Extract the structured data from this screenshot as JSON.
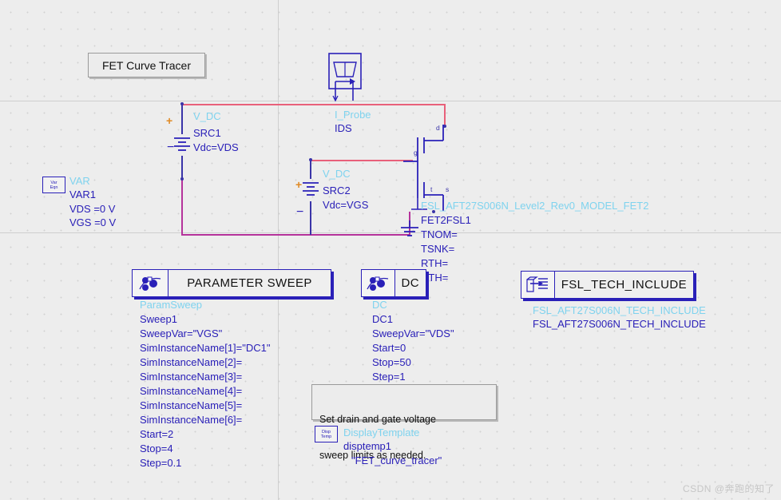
{
  "app": {
    "title_box": "FET Curve Tracer",
    "watermark": "CSDN @奔跑的知了"
  },
  "sources": {
    "src1": {
      "type": "V_DC",
      "name": "SRC1",
      "value": "Vdc=VDS",
      "plus": "+",
      "minus": "−"
    },
    "src2": {
      "type": "V_DC",
      "name": "SRC2",
      "value": "Vdc=VGS",
      "plus": "+",
      "minus": "−"
    }
  },
  "probe": {
    "type": "I_Probe",
    "name": "IDS"
  },
  "var_block": {
    "icon_l1": "Var",
    "icon_l2": "Eqn",
    "type": "VAR",
    "name": "VAR1",
    "params": [
      "VDS =0 V",
      "VGS =0 V"
    ]
  },
  "fet": {
    "model": "FSL_AFT27S006N_Level2_Rev0_MODEL_FET2",
    "name": "FET2FSL1",
    "params": [
      "TNOM=",
      "TSNK=",
      "RTH=",
      "CTH="
    ],
    "terminals": {
      "drain": "d",
      "gate": "g",
      "source": "s",
      "thermal": "t"
    }
  },
  "param_sweep": {
    "caption": "PARAMETER SWEEP",
    "type": "ParamSweep",
    "name": "Sweep1",
    "lines": [
      "SweepVar=\"VGS\"",
      "SimInstanceName[1]=\"DC1\"",
      "SimInstanceName[2]=",
      "SimInstanceName[3]=",
      "SimInstanceName[4]=",
      "SimInstanceName[5]=",
      "SimInstanceName[6]=",
      "Start=2",
      "Stop=4",
      "Step=0.1"
    ]
  },
  "dc_block": {
    "caption": "DC",
    "type": "DC",
    "name": "DC1",
    "lines": [
      "SweepVar=\"VDS\"",
      "Start=0",
      "Stop=50",
      "Step=1"
    ]
  },
  "tech_include": {
    "caption": "FSL_TECH_INCLUDE",
    "type": "FSL_AFT27S006N_TECH_INCLUDE",
    "name": "FSL_AFT27S006N_TECH_INCLUDE"
  },
  "note": {
    "line1": "Set drain and gate voltage",
    "line2": "sweep limits as needed."
  },
  "display_template": {
    "icon_l1": "Disp",
    "icon_l2": "Temp",
    "type": "DisplayTemplate",
    "name": "disptemp1",
    "value": "\"FET_curve_tracer\""
  },
  "colors": {
    "wire_red": "#e8607a",
    "wire_magenta": "#b5339b",
    "symbol_blue": "#2a20b8",
    "type_cyan": "#7fd3ee",
    "plus_orange": "#e08a24",
    "canvas": "#ededed"
  }
}
